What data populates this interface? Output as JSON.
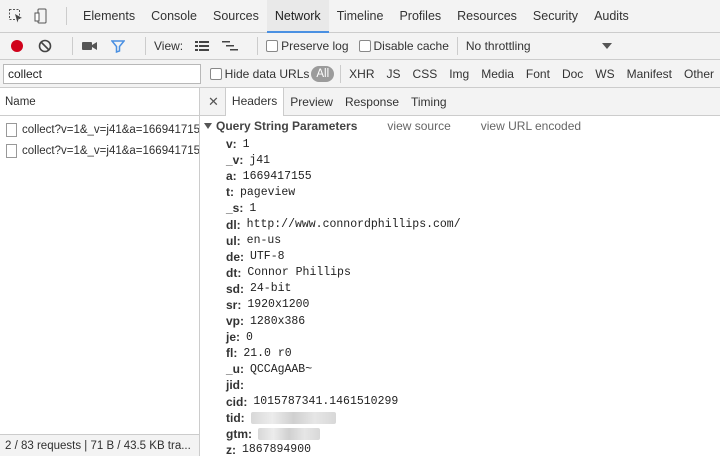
{
  "panel_tabs": [
    "Elements",
    "Console",
    "Sources",
    "Network",
    "Timeline",
    "Profiles",
    "Resources",
    "Security",
    "Audits"
  ],
  "toolbar": {
    "view_label": "View:",
    "preserve_log": "Preserve log",
    "disable_cache": "Disable cache",
    "throttling": "No throttling"
  },
  "filter": {
    "value": "collect",
    "hide_data_urls": "Hide data URLs",
    "all": "All",
    "types": [
      "XHR",
      "JS",
      "CSS",
      "Img",
      "Media",
      "Font",
      "Doc",
      "WS",
      "Manifest",
      "Other"
    ]
  },
  "list": {
    "header": "Name",
    "items": [
      "collect?v=1&_v=j41&a=1669417155...",
      "collect?v=1&_v=j41&a=1669417155..."
    ],
    "status": "2 / 83 requests  |  71 B / 43.5 KB tra..."
  },
  "detail_tabs": [
    "Headers",
    "Preview",
    "Response",
    "Timing"
  ],
  "section": {
    "title": "Query String Parameters",
    "view_source": "view source",
    "view_url_encoded": "view URL encoded"
  },
  "params": [
    {
      "key": "v:",
      "value": "1"
    },
    {
      "key": "_v:",
      "value": "j41"
    },
    {
      "key": "a:",
      "value": "1669417155"
    },
    {
      "key": "t:",
      "value": "pageview"
    },
    {
      "key": "_s:",
      "value": "1"
    },
    {
      "key": "dl:",
      "value": "http://www.connordphillips.com/"
    },
    {
      "key": "ul:",
      "value": "en-us"
    },
    {
      "key": "de:",
      "value": "UTF-8"
    },
    {
      "key": "dt:",
      "value": "Connor Phillips"
    },
    {
      "key": "sd:",
      "value": "24-bit"
    },
    {
      "key": "sr:",
      "value": "1920x1200"
    },
    {
      "key": "vp:",
      "value": "1280x386"
    },
    {
      "key": "je:",
      "value": "0"
    },
    {
      "key": "fl:",
      "value": "21.0 r0"
    },
    {
      "key": "_u:",
      "value": "QCCAgAAB~"
    },
    {
      "key": "jid:",
      "value": ""
    },
    {
      "key": "cid:",
      "value": "1015787341.1461510299"
    },
    {
      "key": "tid:",
      "value": ""
    },
    {
      "key": "gtm:",
      "value": ""
    },
    {
      "key": "z:",
      "value": "1867894900"
    }
  ],
  "colors": {
    "record": "#d0021b",
    "accent": "#4a90e2"
  }
}
